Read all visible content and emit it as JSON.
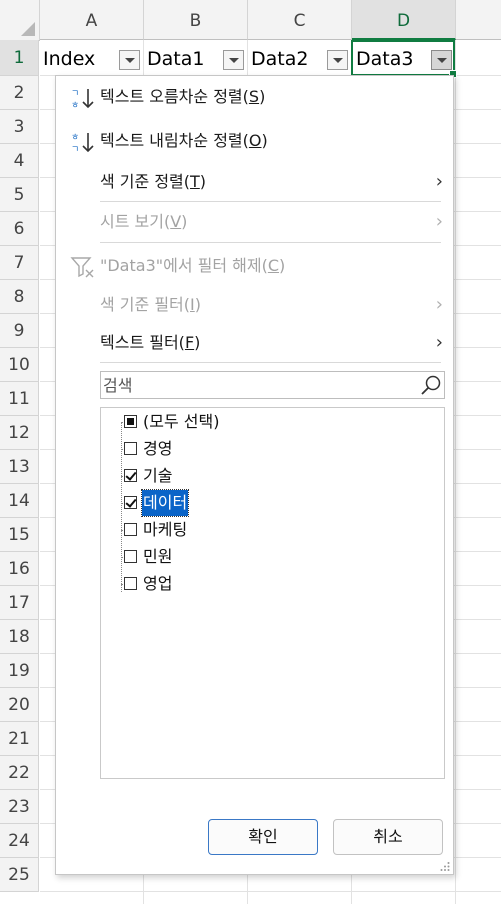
{
  "columns": [
    "A",
    "B",
    "C",
    "D"
  ],
  "rows": [
    "1",
    "2",
    "3",
    "4",
    "5",
    "6",
    "7",
    "8",
    "9",
    "10",
    "11",
    "12",
    "13",
    "14",
    "15",
    "16",
    "17",
    "18",
    "19",
    "20",
    "21",
    "22",
    "23",
    "24",
    "25"
  ],
  "cells": {
    "a1": "Index",
    "b1": "Data1",
    "c1": "Data2",
    "d1": "Data3"
  },
  "menu": {
    "sort_asc": {
      "text": "텍스트 오름차순 정렬(",
      "key": "S",
      "end": ")"
    },
    "sort_desc": {
      "text": "텍스트 내림차순 정렬(",
      "key": "O",
      "end": ")"
    },
    "sort_by_color": {
      "text": "색 기준 정렬(",
      "key": "T",
      "end": ")"
    },
    "sheet_view": {
      "text": "시트 보기(",
      "key": "V",
      "end": ")"
    },
    "clear_filter": {
      "text": "\"Data3\"에서 필터 해제(",
      "key": "C",
      "end": ")"
    },
    "filter_by_color": {
      "text": "색 기준 필터(",
      "key": "I",
      "end": ")"
    },
    "text_filter": {
      "text": "텍스트 필터(",
      "key": "F",
      "end": ")"
    }
  },
  "search": {
    "placeholder": "검색"
  },
  "list_items": [
    {
      "label": "(모두 선택)",
      "state": "partial"
    },
    {
      "label": "경영",
      "state": "unchecked"
    },
    {
      "label": "기술",
      "state": "checked"
    },
    {
      "label": "데이터",
      "state": "checked",
      "highlighted": true
    },
    {
      "label": "마케팅",
      "state": "unchecked"
    },
    {
      "label": "민원",
      "state": "unchecked"
    },
    {
      "label": "영업",
      "state": "unchecked"
    }
  ],
  "buttons": {
    "ok": "확인",
    "cancel": "취소"
  },
  "colors": {
    "accent": "#107c41",
    "highlight": "#0a64c8",
    "icon_blue": "#1f6fc5"
  }
}
